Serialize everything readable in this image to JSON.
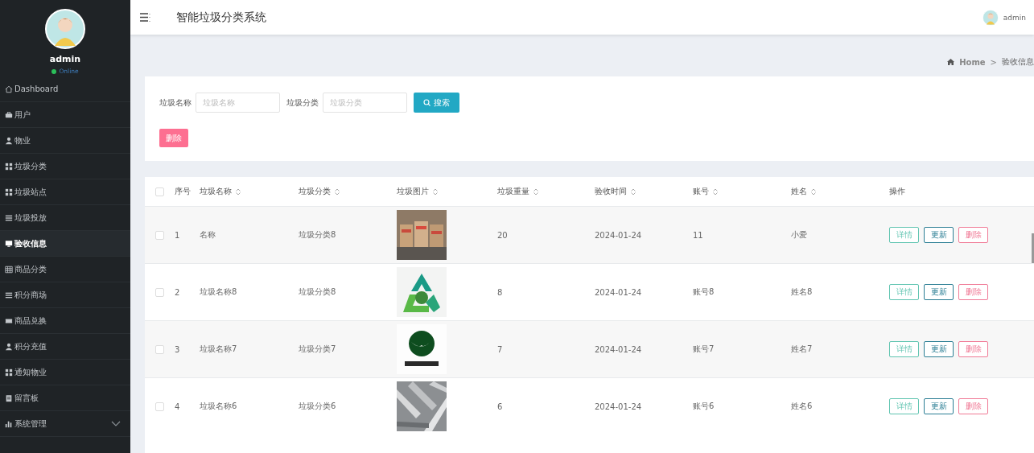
{
  "sidebar": {
    "user": {
      "name": "admin",
      "status": "Online"
    },
    "items": [
      {
        "label": "Dashboard",
        "selected": false
      },
      {
        "label": "用户",
        "selected": false
      },
      {
        "label": "物业",
        "selected": false
      },
      {
        "label": "垃圾分类",
        "selected": false
      },
      {
        "label": "垃圾站点",
        "selected": false
      },
      {
        "label": "垃圾投放",
        "selected": false
      },
      {
        "label": "验收信息",
        "selected": true
      },
      {
        "label": "商品分类",
        "selected": false
      },
      {
        "label": "积分商场",
        "selected": false
      },
      {
        "label": "商品兑换",
        "selected": false
      },
      {
        "label": "积分充值",
        "selected": false
      },
      {
        "label": "通知物业",
        "selected": false
      },
      {
        "label": "留言板",
        "selected": false
      },
      {
        "label": "系统管理",
        "selected": false,
        "expanded": false
      }
    ]
  },
  "topbar": {
    "title": "智能垃圾分类系统",
    "user": "admin"
  },
  "breadcrumb": {
    "items": [
      "Home",
      "验收信息"
    ],
    "separator": ">"
  },
  "search": {
    "fields": [
      {
        "label": "垃圾名称",
        "placeholder": "垃圾名称"
      },
      {
        "label": "垃圾分类",
        "placeholder": "垃圾分类"
      }
    ],
    "button": "搜索",
    "delete_button": "删除"
  },
  "table": {
    "select_all": {
      "checked": false
    },
    "columns": [
      {
        "label": "序号",
        "sortable": false
      },
      {
        "label": "垃圾名称",
        "sortable": true
      },
      {
        "label": "垃圾分类",
        "sortable": true
      },
      {
        "label": "垃圾图片",
        "sortable": true
      },
      {
        "label": "垃圾重量",
        "sortable": true
      },
      {
        "label": "验收时间",
        "sortable": true
      },
      {
        "label": "账号",
        "sortable": true
      },
      {
        "label": "姓名",
        "sortable": true
      },
      {
        "label": "操作",
        "sortable": false
      }
    ],
    "rows": [
      {
        "checked": false,
        "cells": [
          "1",
          "名称",
          "垃圾分类8",
          {
            "kind": "picture"
          },
          "20",
          "2024-01-24",
          "11",
          "小爱"
        ],
        "actions": [
          {
            "label": "详情",
            "kind": "detail"
          },
          {
            "label": "更新",
            "kind": "update"
          },
          {
            "label": "删除",
            "kind": "delete"
          }
        ]
      },
      {
        "checked": false,
        "cells": [
          "2",
          "垃圾名称8",
          "垃圾分类8",
          {
            "kind": "picture"
          },
          "8",
          "2024-01-24",
          "账号8",
          "姓名8"
        ],
        "actions": [
          {
            "label": "详情",
            "kind": "detail"
          },
          {
            "label": "更新",
            "kind": "update"
          },
          {
            "label": "删除",
            "kind": "delete"
          }
        ]
      },
      {
        "checked": false,
        "cells": [
          "3",
          "垃圾名称7",
          "垃圾分类7",
          {
            "kind": "picture"
          },
          "7",
          "2024-01-24",
          "账号7",
          "姓名7"
        ],
        "actions": [
          {
            "label": "详情",
            "kind": "detail"
          },
          {
            "label": "更新",
            "kind": "update"
          },
          {
            "label": "删除",
            "kind": "delete"
          }
        ]
      },
      {
        "checked": false,
        "cells": [
          "4",
          "垃圾名称6",
          "垃圾分类6",
          {
            "kind": "picture"
          },
          "6",
          "2024-01-24",
          "账号6",
          "姓名6"
        ],
        "actions": [
          {
            "label": "详情",
            "kind": "detail"
          },
          {
            "label": "更新",
            "kind": "update"
          },
          {
            "label": "删除",
            "kind": "delete"
          }
        ]
      }
    ]
  }
}
